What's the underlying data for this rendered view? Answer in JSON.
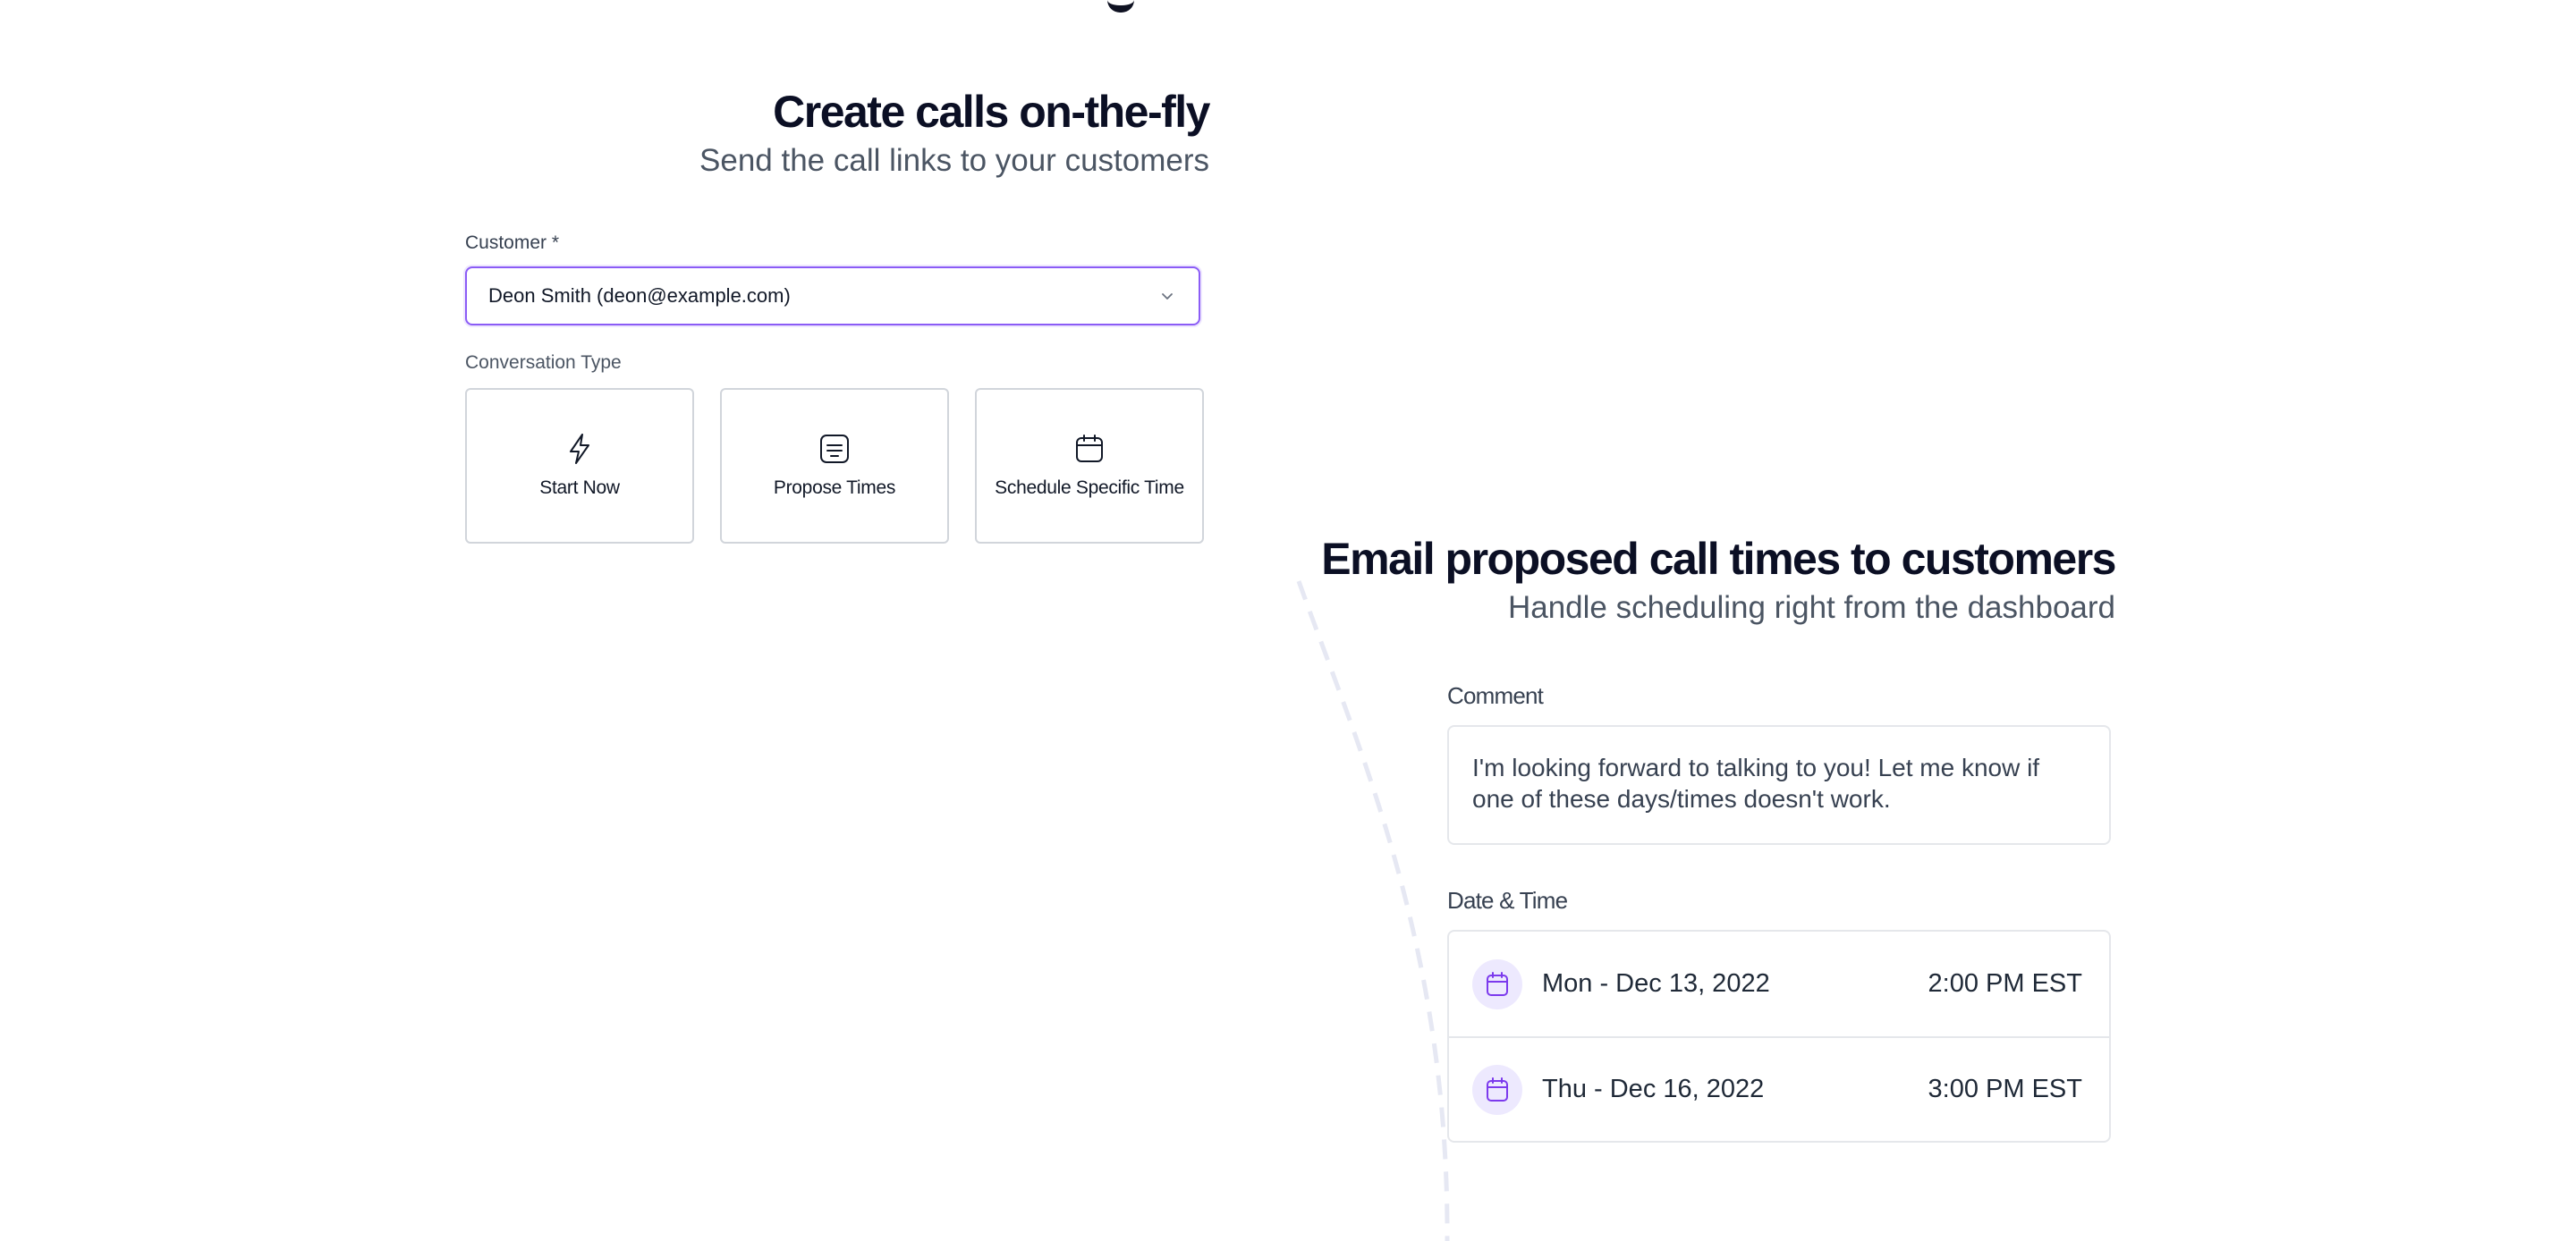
{
  "section1": {
    "title": "Create calls on-the-fly",
    "subtitle": "Send the call links to your customers",
    "customer_label": "Customer *",
    "customer_value": "Deon Smith (deon@example.com)",
    "conversation_type_label": "Conversation Type",
    "conversation_types": [
      {
        "label": "Start Now",
        "icon": "lightning-icon"
      },
      {
        "label": "Propose Times",
        "icon": "document-icon"
      },
      {
        "label": "Schedule Specific Time",
        "icon": "calendar-icon"
      }
    ]
  },
  "section2": {
    "title": "Email proposed call times to customers",
    "subtitle": "Handle scheduling right from the dashboard",
    "comment_label": "Comment",
    "comment_text": "I'm looking forward to talking to you! Let me know if one of these days/times doesn't work.",
    "datetime_label": "Date & Time",
    "datetimes": [
      {
        "date": "Mon - Dec 13, 2022",
        "time": "2:00 PM EST"
      },
      {
        "date": "Thu - Dec 16, 2022",
        "time": "3:00 PM EST"
      }
    ]
  },
  "colors": {
    "accent": "#8b5cf6",
    "accent_soft": "#ede9fe",
    "heading": "#0b0f24",
    "muted": "#4b5563",
    "border": "#d1d5db"
  }
}
